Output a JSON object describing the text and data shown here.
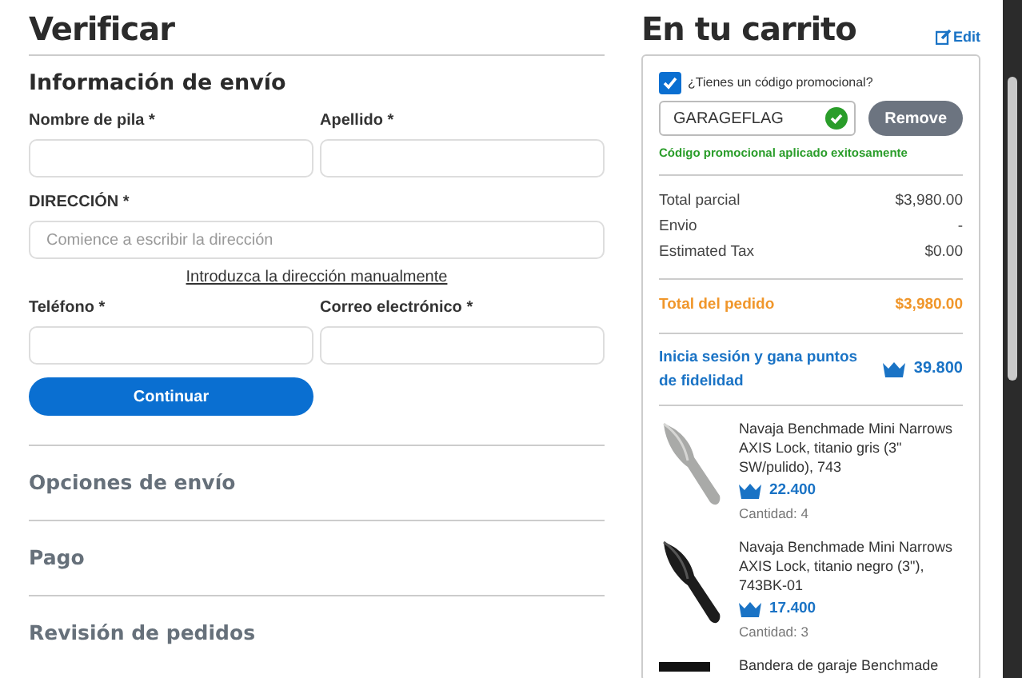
{
  "page_title": "Verificar",
  "shipping": {
    "title": "Información de envío",
    "name_fields": [
      {
        "label": "Nombre de pila *"
      },
      {
        "label": "Apellido *"
      }
    ],
    "address": {
      "label": "DIRECCIÓN *",
      "placeholder": "Comience a escribir la dirección"
    },
    "manual_link": "Introduzca la dirección manualmente",
    "contact_fields": [
      {
        "label": "Teléfono *"
      },
      {
        "label": "Correo electrónico *"
      }
    ],
    "button": "Continuar"
  },
  "sections": [
    "Opciones de envío",
    "Pago",
    "Revisión de pedidos"
  ],
  "cart": {
    "title": "En tu carrito",
    "edit": "Edit",
    "promo": {
      "checked": true,
      "label": "¿Tienes un código promocional?",
      "code": "GARAGEFLAG",
      "valid": true,
      "button": "Remove",
      "message": "Código promocional aplicado exitosamente"
    },
    "summary": [
      {
        "label": "Total parcial",
        "value": "$3,980.00"
      },
      {
        "label": "Envio",
        "value": "-"
      },
      {
        "label": "Estimated Tax",
        "value": "$0.00"
      }
    ],
    "total": {
      "label": "Total del pedido",
      "value": "$3,980.00"
    },
    "loyalty": {
      "text": "Inicia sesión y gana puntos de fidelidad",
      "points": "39.800"
    },
    "items": [
      {
        "kind": "silver-knife",
        "name": "Navaja Benchmade Mini Narrows AXIS Lock, titanio gris (3\" SW/pulido), 743",
        "points": "22.400",
        "quantity": "Cantidad: 4"
      },
      {
        "kind": "black-knife",
        "name": "Navaja Benchmade Mini Narrows AXIS Lock, titanio negro (3\"), 743BK-01",
        "points": "17.400",
        "quantity": "Cantidad: 3"
      },
      {
        "kind": "flag",
        "name": "Bandera de garaje Benchmade"
      }
    ]
  }
}
